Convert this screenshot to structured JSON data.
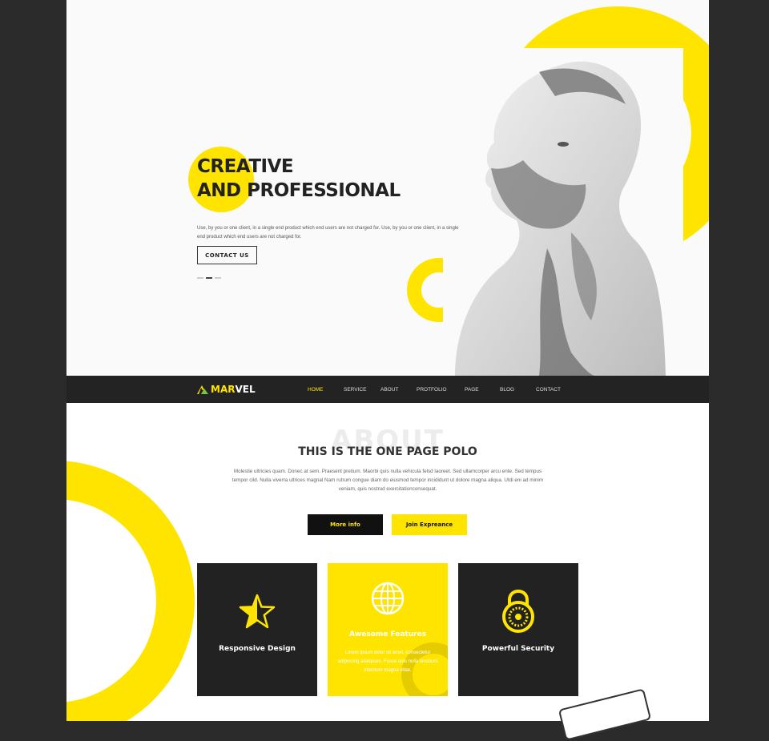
{
  "hero": {
    "title_line1": "CREATIVE",
    "title_line2": "AND PROFESSIONAL",
    "description": "Use, by you or one client, in a single end product which end users are not charged for. Use, by you or one client, in a single end product which end users are not charged for.",
    "button_label": "CONTACT US"
  },
  "nav": {
    "logo_prefix": "MAR",
    "logo_suffix": "VEL",
    "items": [
      {
        "label": "HOME",
        "active": true
      },
      {
        "label": "SERVICE",
        "active": false
      },
      {
        "label": "ABOUT",
        "active": false
      },
      {
        "label": "PROTFOLIO",
        "active": false
      },
      {
        "label": "PAGE",
        "active": false
      },
      {
        "label": "BLOG",
        "active": false
      },
      {
        "label": "CONTACT",
        "active": false
      }
    ]
  },
  "about": {
    "ghost_word": "ABOUT",
    "title": "THIS IS THE ONE PAGE POLO",
    "description": "Molestie ultricies quam. Donec at sem. Praesent pretium. Maorbi quis nulla vehicula felsd laoreet. Sed ullamcorper arcu ente. Sed tempus tempor cild. Nulla viverra ultrices magnal Nam rutrum congue diam do eiusmod tempor incididunt ut dolore magna aliqua. Utdi eni ad minim veniam, quis nostrud exercitationconsequat.",
    "primary_button": "More info",
    "secondary_button": "Join Expreance"
  },
  "cards": [
    {
      "title": "Responsive Design",
      "icon": "star-icon",
      "text": ""
    },
    {
      "title": "Awesome Features",
      "icon": "globe-icon",
      "text": "Lorem ipsum dolor sit amet, consectetur adipiscing aliaiquam. Fusce quis nulla tincidunt interdum magna vitae."
    },
    {
      "title": "Powerful Security",
      "icon": "padlock-icon",
      "text": ""
    }
  ],
  "colors": {
    "accent": "#ffe400",
    "dark": "#222222",
    "frame": "#2b2b2b"
  }
}
